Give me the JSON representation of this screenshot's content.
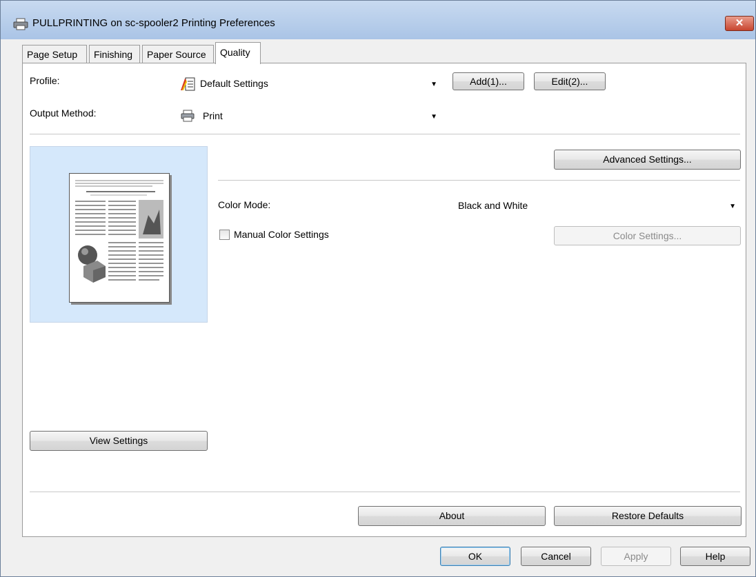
{
  "window": {
    "title": "PULLPRINTING on sc-spooler2 Printing Preferences",
    "close_glyph": "✕"
  },
  "tabs": [
    {
      "label": "Page Setup"
    },
    {
      "label": "Finishing"
    },
    {
      "label": "Paper Source"
    },
    {
      "label": "Quality"
    }
  ],
  "profile": {
    "label": "Profile:",
    "value": "Default Settings",
    "add_button": "Add(1)...",
    "edit_button": "Edit(2)..."
  },
  "output_method": {
    "label": "Output Method:",
    "value": "Print"
  },
  "preview": {
    "view_settings_button": "View Settings"
  },
  "quality": {
    "advanced_settings_button": "Advanced Settings...",
    "color_mode_label": "Color Mode:",
    "color_mode_value": "Black and White",
    "manual_color_label": "Manual Color Settings",
    "color_settings_button": "Color Settings..."
  },
  "panel_footer": {
    "about_button": "About",
    "restore_defaults_button": "Restore Defaults"
  },
  "dialog_buttons": {
    "ok": "OK",
    "cancel": "Cancel",
    "apply": "Apply",
    "help": "Help"
  },
  "icons": {
    "printer": "printer-icon",
    "profile": "profile-icon",
    "dropdown": "chevron-down-icon",
    "close": "close-icon"
  },
  "colors": {
    "preview_background": "#d5e8fb",
    "close_button": "#c8452f",
    "titlebar": "#b9cfeb"
  }
}
